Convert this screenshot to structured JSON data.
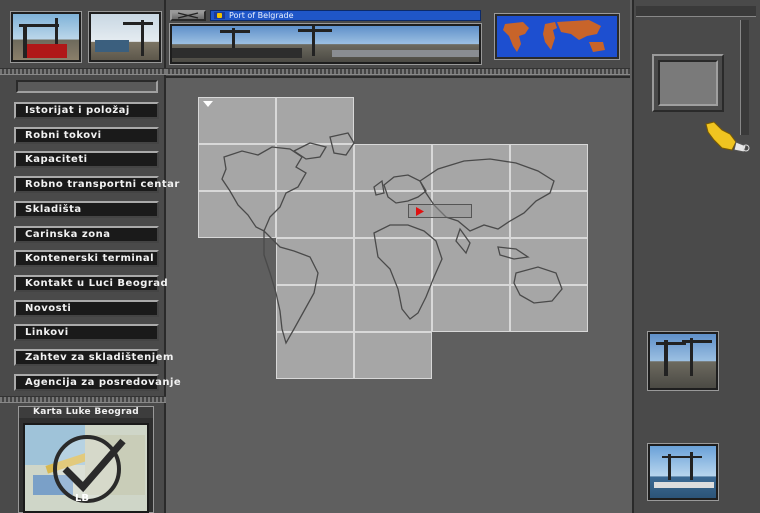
{
  "header": {
    "title": "Port of Belgrade",
    "close_icon": "x-icon"
  },
  "nav": {
    "items": [
      {
        "label": "Istorijat i položaj"
      },
      {
        "label": "Robni tokovi"
      },
      {
        "label": "Kapaciteti"
      },
      {
        "label": "Robno transportni centar"
      },
      {
        "label": "Skladišta"
      },
      {
        "label": "Carinska zona"
      },
      {
        "label": "Kontenerski terminal"
      },
      {
        "label": "Kontakt u Luci Beograd"
      },
      {
        "label": "Novosti"
      },
      {
        "label": "Linkovi"
      },
      {
        "label": "Zahtev za skladištenjem"
      },
      {
        "label": "Agencija za posredovanje"
      }
    ]
  },
  "map_card": {
    "title": "Karta Luke Beograd",
    "logo_text": "LB"
  },
  "colors": {
    "title_bar": "#1f56c8",
    "world_map_ocean": "#1d4fd0",
    "world_map_land": "#c8642a",
    "grid_cell": "#a6a6a6",
    "marker": "#e01010"
  },
  "icons": {
    "pointer": "hand-pointer-icon",
    "flag": "flag-icon",
    "marker": "play-marker-icon"
  }
}
